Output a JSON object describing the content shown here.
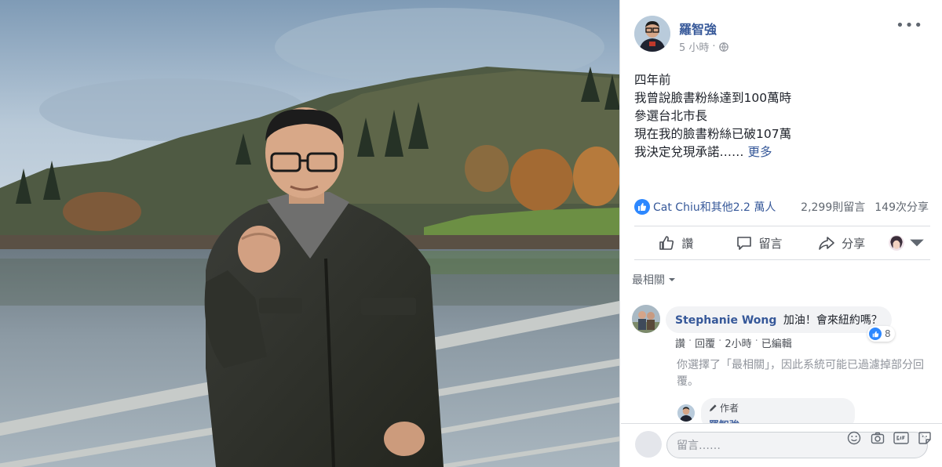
{
  "post": {
    "author": "羅智強",
    "time": "5 小時",
    "body_lines": [
      "四年前",
      "我曾說臉書粉絲達到100萬時",
      "參選台北市長",
      "現在我的臉書粉絲已破107萬",
      "我決定兌現承諾……"
    ],
    "see_more": "更多",
    "reactions_text": "Cat Chiu和其他2.2 萬人",
    "comments_count": "2,299則留言",
    "shares_count": "149次分享"
  },
  "actions": {
    "like": "讚",
    "comment": "留言",
    "share": "分享"
  },
  "comments": {
    "sort_label": "最相關",
    "first": {
      "author": "Stephanie Wong",
      "text": "加油！會來紐約嗎？",
      "reaction_count": "8",
      "like": "讚",
      "reply": "回覆",
      "time": "2小時",
      "edited": "已編輯"
    },
    "filter_note": "你選擇了「最相關」，因此系統可能已過濾掉部分回覆。",
    "reply": {
      "author_tag": "作者",
      "author": "羅智強"
    },
    "composer_placeholder": "留言……"
  },
  "colors": {
    "link": "#365899",
    "like_blue": "#2d88ff",
    "muted": "#90949c"
  },
  "icons": [
    "globe-icon",
    "more-icon",
    "like-icon",
    "comment-icon",
    "share-icon",
    "chevron-down-icon",
    "pencil-icon",
    "emoji-icon",
    "camera-icon",
    "gif-icon",
    "sticker-icon"
  ]
}
